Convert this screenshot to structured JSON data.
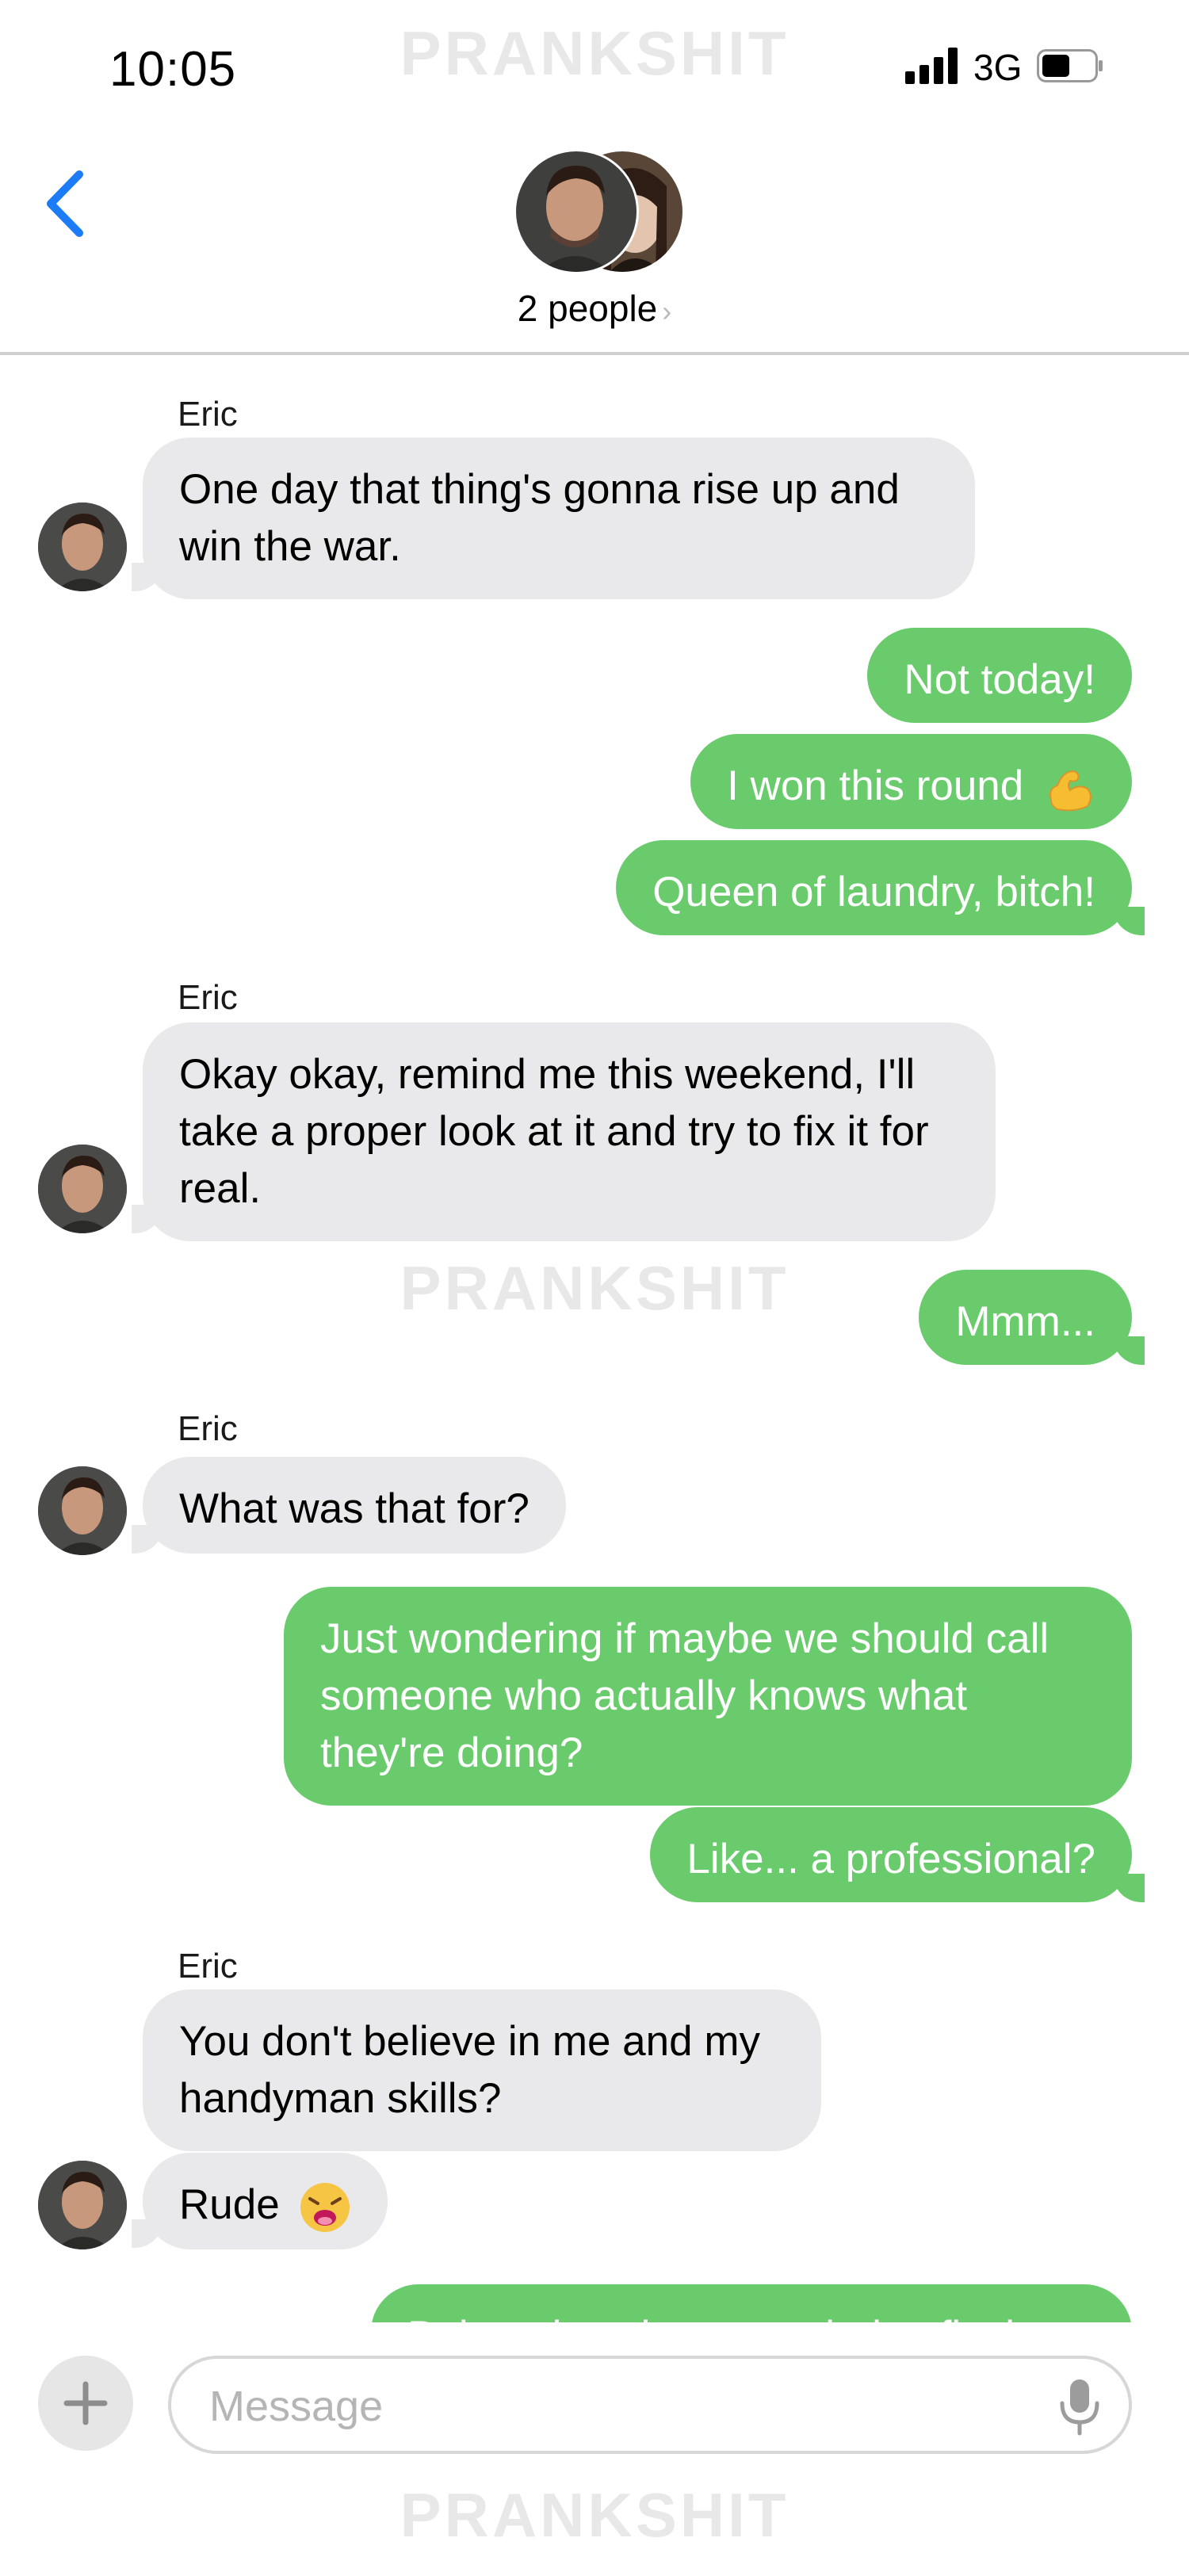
{
  "status_bar": {
    "time": "10:05",
    "network": "3G",
    "watermark": "PRANKSHIT"
  },
  "header": {
    "title": "2 people",
    "chevron": "›",
    "back_icon": "chevron-left-icon"
  },
  "messages": [
    {
      "sender": "Eric",
      "direction": "incoming",
      "lines": [
        "One day that thing's gonna rise up and",
        "win the war."
      ]
    },
    {
      "direction": "outgoing",
      "lines": [
        "Not today!"
      ]
    },
    {
      "direction": "outgoing",
      "lines": [
        "I won this round"
      ],
      "emoji": "flexed-biceps-emoji"
    },
    {
      "direction": "outgoing",
      "lines": [
        "Queen of laundry, bitch!"
      ]
    },
    {
      "sender": "Eric",
      "direction": "incoming",
      "lines": [
        "Okay okay, remind me this weekend, I'll",
        "take a proper look at it and try to fix it for",
        "real."
      ]
    },
    {
      "direction": "outgoing",
      "lines": [
        "Mmm..."
      ]
    },
    {
      "sender": "Eric",
      "direction": "incoming",
      "lines": [
        "What was that for?"
      ]
    },
    {
      "direction": "outgoing",
      "lines": [
        "Just wondering if maybe we should call",
        "someone who actually knows what",
        "they're doing?"
      ]
    },
    {
      "direction": "outgoing",
      "lines": [
        "Like... a professional?"
      ]
    },
    {
      "sender": "Eric",
      "direction": "incoming",
      "lines": [
        "You don't believe in me and my",
        "handyman skills?"
      ]
    },
    {
      "direction": "incoming",
      "lines": [
        "Rude"
      ],
      "emoji": "weary-face-emoji"
    },
    {
      "direction": "outgoing",
      "lines": [
        "Babe... last time you tried to fix the"
      ]
    }
  ],
  "composer": {
    "placeholder": "Message",
    "plus_icon": "plus-icon",
    "mic_icon": "microphone-icon"
  },
  "colors": {
    "outgoing_bubble": "#6acb6d",
    "incoming_bubble": "#e9e9eb",
    "accent": "#1b7cf5"
  }
}
